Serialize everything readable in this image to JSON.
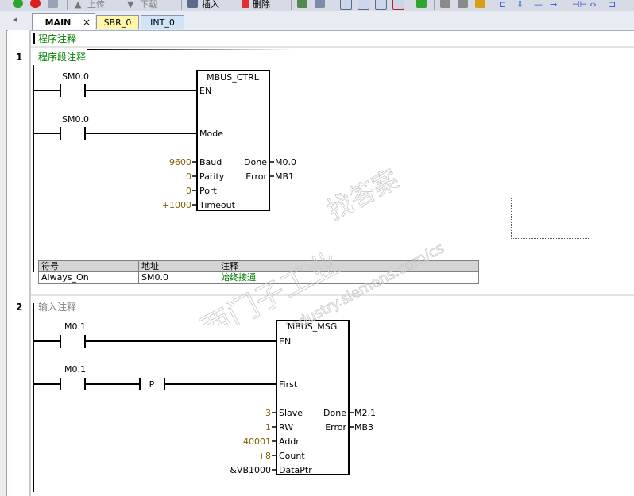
{
  "toolbar": {
    "upload_label": "上传",
    "download_label": "下载",
    "insert_label": "插入",
    "delete_label": "删除"
  },
  "tabs": [
    {
      "label": "MAIN",
      "close": "×"
    },
    {
      "label": "SBR_0"
    },
    {
      "label": "INT_0"
    }
  ],
  "program_comment": "程序注释",
  "networks": [
    {
      "number": "1",
      "comment": "程序段注释",
      "contacts": [
        "SM0.0",
        "SM0.0"
      ],
      "block": {
        "title": "MBUS_CTRL",
        "en_pin": "EN",
        "mode_pin": "Mode",
        "inputs": [
          {
            "value": "9600",
            "pin": "Baud"
          },
          {
            "value": "0",
            "pin": "Parity"
          },
          {
            "value": "0",
            "pin": "Port"
          },
          {
            "value": "+1000",
            "pin": "Timeout"
          }
        ],
        "outputs": [
          {
            "pin": "Done",
            "value": "M0.0"
          },
          {
            "pin": "Error",
            "value": "MB1"
          }
        ]
      },
      "symbol_table": {
        "headers": [
          "符号",
          "地址",
          "注释"
        ],
        "rows": [
          [
            "Always_On",
            "SM0.0",
            "始终接通"
          ]
        ]
      }
    },
    {
      "number": "2",
      "comment": "输入注释",
      "contacts": [
        "M0.1",
        "M0.1"
      ],
      "p_contact": "P",
      "block": {
        "title": "MBUS_MSG",
        "en_pin": "EN",
        "first_pin": "First",
        "inputs": [
          {
            "value": "3",
            "pin": "Slave"
          },
          {
            "value": "1",
            "pin": "RW"
          },
          {
            "value": "40001",
            "pin": "Addr"
          },
          {
            "value": "+8",
            "pin": "Count"
          },
          {
            "value": "&VB1000",
            "pin": "DataPtr"
          }
        ],
        "outputs": [
          {
            "pin": "Done",
            "value": "M2.1"
          },
          {
            "pin": "Error",
            "value": "MB3"
          }
        ]
      }
    }
  ],
  "watermark": {
    "line1": "西门子工业",
    "line2": "找答案",
    "line3": "support.industry.siemens.com/cs"
  }
}
